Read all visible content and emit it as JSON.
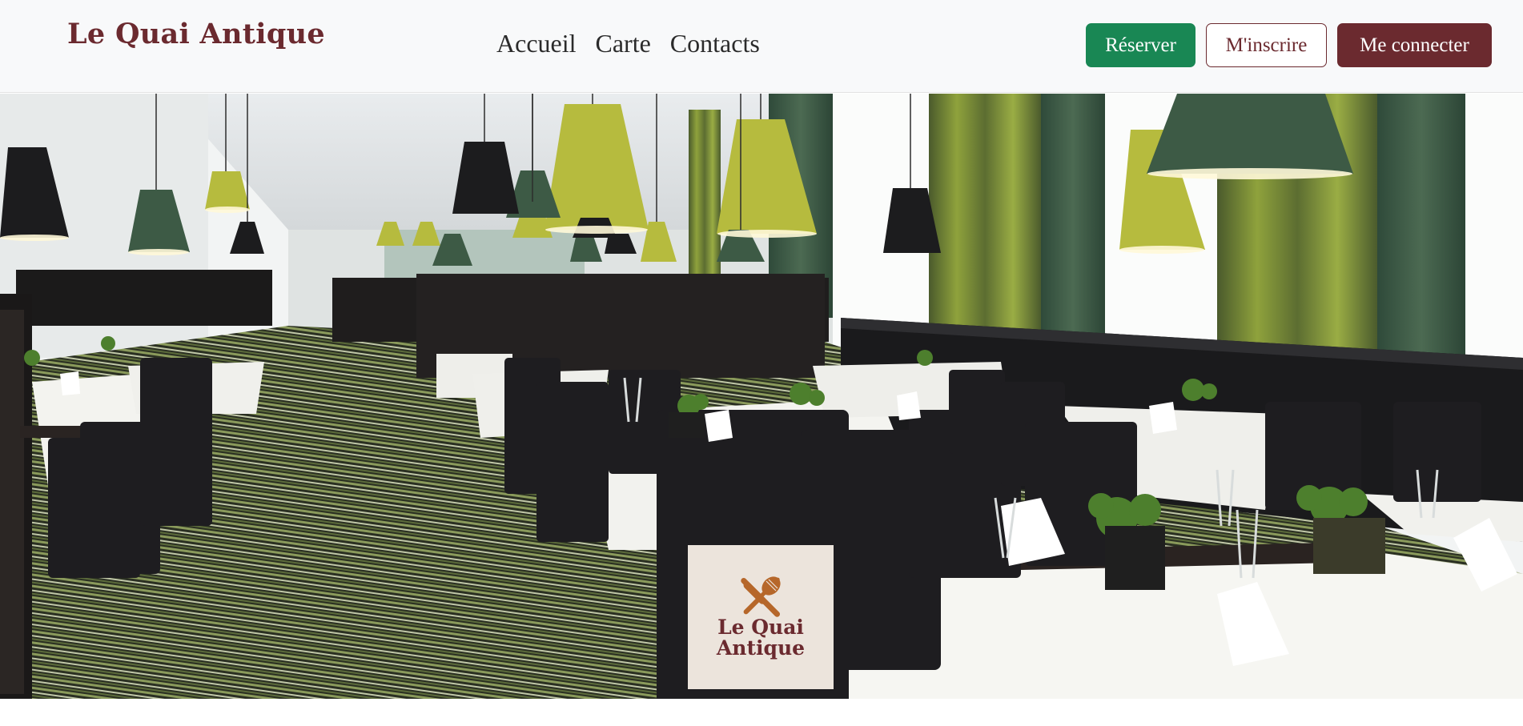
{
  "header": {
    "brand": "Le Quai Antique",
    "nav": [
      {
        "label": "Accueil"
      },
      {
        "label": "Carte"
      },
      {
        "label": "Contacts"
      }
    ],
    "buttons": {
      "reserve": "Réserver",
      "signup": "M'inscrire",
      "login": "Me connecter"
    }
  },
  "hero": {
    "logo_line1": "Le Quai",
    "logo_line2": "Antique",
    "logo_icon": "utensils-icon"
  },
  "colors": {
    "brand": "#6b2a2f",
    "reserve": "#198754",
    "navbar_bg": "#f8f9fa",
    "logo_bg": "#ece4dc",
    "logo_icon": "#b6672a"
  }
}
